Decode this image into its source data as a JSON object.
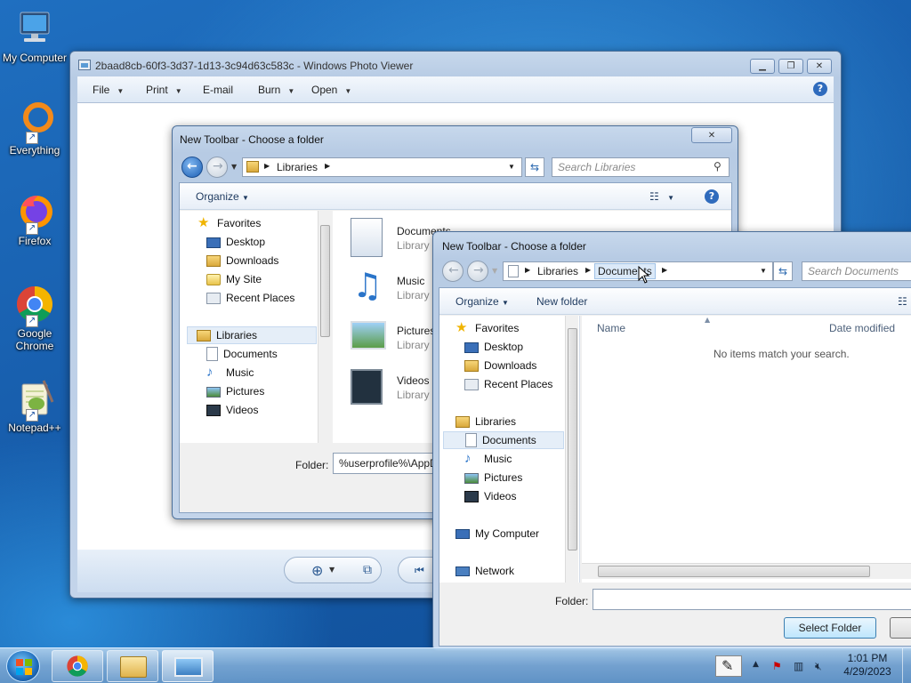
{
  "desktop": {
    "icons": [
      {
        "label": "My Computer"
      },
      {
        "label": "Everything"
      },
      {
        "label": "Firefox"
      },
      {
        "label": "Google Chrome"
      },
      {
        "label": "Notepad++"
      }
    ]
  },
  "photo_viewer": {
    "title": "2baad8cb-60f3-3d37-1d13-3c94d63c583c - Windows Photo Viewer",
    "menu": [
      {
        "label": "File"
      },
      {
        "label": "Print"
      },
      {
        "label": "E-mail"
      },
      {
        "label": "Burn"
      },
      {
        "label": "Open"
      }
    ]
  },
  "dialog1": {
    "title": "New Toolbar - Choose a folder",
    "breadcrumb": "Libraries",
    "search_placeholder": "Search Libraries",
    "organize": "Organize",
    "favorites": "Favorites",
    "fav_items": [
      {
        "label": "Desktop"
      },
      {
        "label": "Downloads"
      },
      {
        "label": "My Site"
      },
      {
        "label": "Recent Places"
      }
    ],
    "libraries": "Libraries",
    "lib_items": [
      {
        "label": "Documents"
      },
      {
        "label": "Music"
      },
      {
        "label": "Pictures"
      },
      {
        "label": "Videos"
      }
    ],
    "content_items": [
      {
        "name": "Documents",
        "type": "Library"
      },
      {
        "name": "Music",
        "type": "Library"
      },
      {
        "name": "Pictures",
        "type": "Library"
      },
      {
        "name": "Videos",
        "type": "Library"
      }
    ],
    "folder_label": "Folder:",
    "folder_value": "%userprofile%\\AppData"
  },
  "dialog2": {
    "title": "New Toolbar - Choose a folder",
    "breadcrumb": [
      "Libraries",
      "Documents"
    ],
    "search_placeholder": "Search Documents",
    "organize": "Organize",
    "new_folder": "New folder",
    "favorites": "Favorites",
    "fav_items": [
      {
        "label": "Desktop"
      },
      {
        "label": "Downloads"
      },
      {
        "label": "Recent Places"
      }
    ],
    "libraries": "Libraries",
    "lib_items": [
      {
        "label": "Documents"
      },
      {
        "label": "Music"
      },
      {
        "label": "Pictures"
      },
      {
        "label": "Videos"
      }
    ],
    "my_computer": "My Computer",
    "network": "Network",
    "col_name": "Name",
    "col_date": "Date modified",
    "empty_text": "No items match your search.",
    "folder_label": "Folder:",
    "folder_value": "",
    "select_button": "Select Folder"
  },
  "taskbar": {
    "time": "1:01 PM",
    "date": "4/29/2023"
  }
}
